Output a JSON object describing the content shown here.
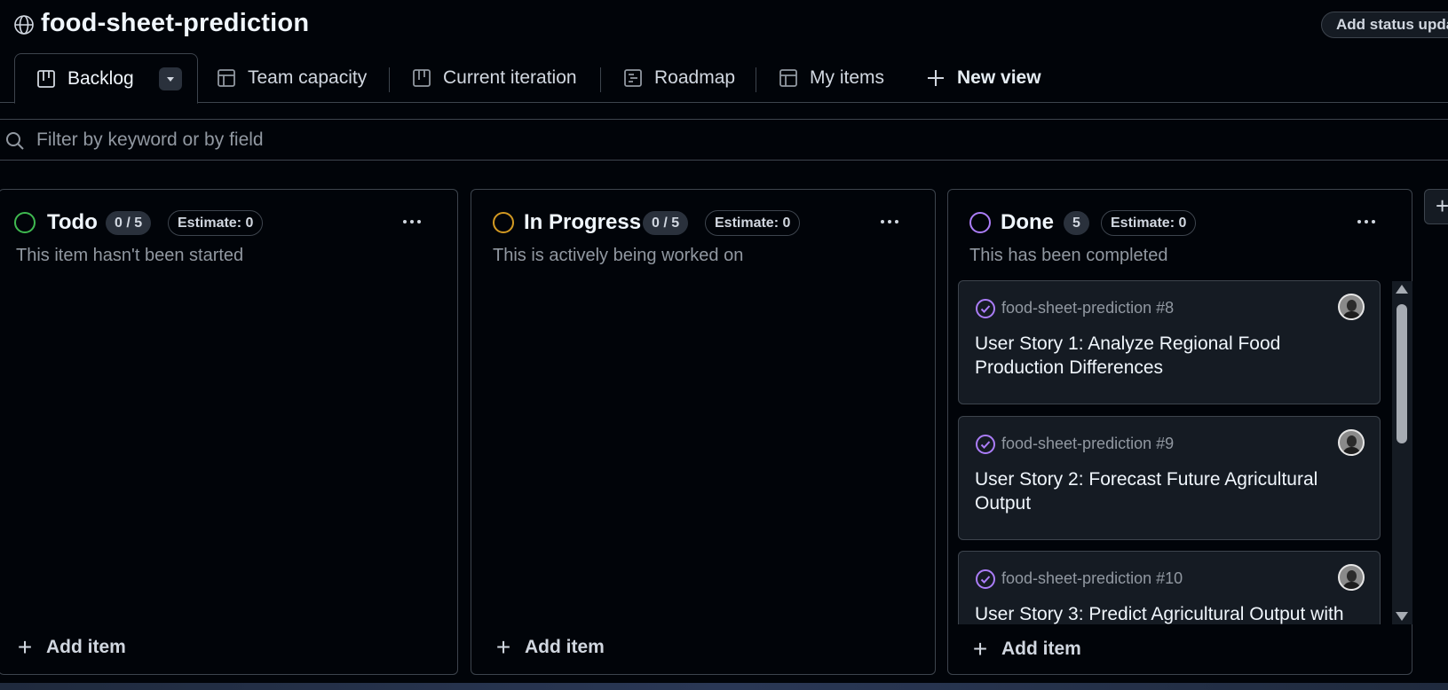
{
  "header": {
    "project_title": "food-sheet-prediction",
    "status_button": "Add status update",
    "globe_icon": "globe-icon"
  },
  "tabs": [
    {
      "label": "Backlog",
      "icon": "board-icon",
      "active": true
    },
    {
      "label": "Team capacity",
      "icon": "table-icon"
    },
    {
      "label": "Current iteration",
      "icon": "board-icon"
    },
    {
      "label": "Roadmap",
      "icon": "roadmap-icon"
    },
    {
      "label": "My items",
      "icon": "table-icon"
    },
    {
      "label": "New view",
      "icon": "plus-icon"
    }
  ],
  "filter": {
    "placeholder": "Filter by keyword or by field"
  },
  "columns": [
    {
      "title": "Todo",
      "count": "0 / 5",
      "estimate": "Estimate: 0",
      "description": "This item hasn't been started",
      "color": "#3fb950",
      "add_label": "Add item",
      "cards": []
    },
    {
      "title": "In Progress",
      "count": "0 / 5",
      "estimate": "Estimate: 0",
      "description": "This is actively being worked on",
      "color": "#d29922",
      "add_label": "Add item",
      "cards": []
    },
    {
      "title": "Done",
      "count": "5",
      "estimate": "Estimate: 0",
      "description": "This has been completed",
      "color": "#ab7df8",
      "add_label": "Add item",
      "cards": [
        {
          "ref": "food-sheet-prediction #8",
          "title": "User Story 1: Analyze Regional Food Production Differences"
        },
        {
          "ref": "food-sheet-prediction #9",
          "title": "User Story 2: Forecast Future Agricultural Output"
        },
        {
          "ref": "food-sheet-prediction #10",
          "title": "User Story 3: Predict Agricultural Output with"
        }
      ]
    }
  ],
  "new_column_button": "+"
}
